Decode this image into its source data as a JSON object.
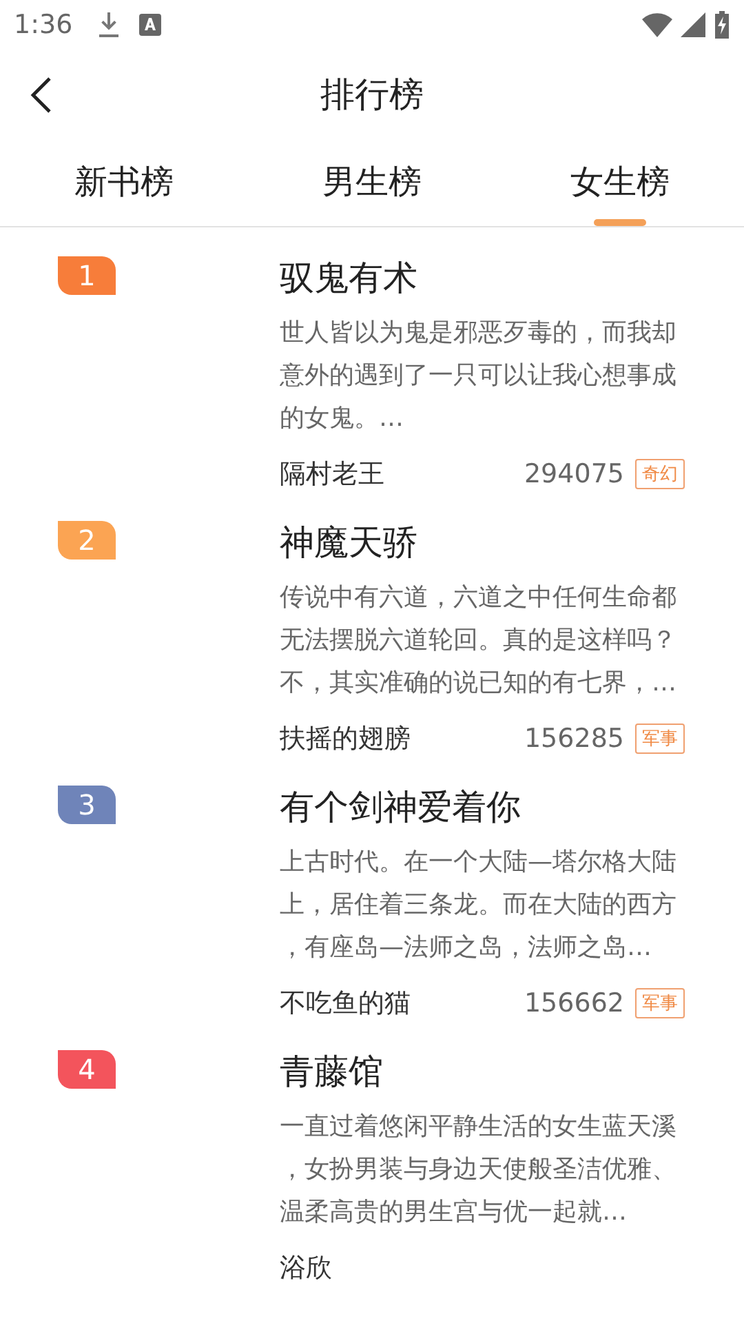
{
  "status_bar": {
    "time": "1:36"
  },
  "header": {
    "title": "排行榜"
  },
  "tabs": [
    {
      "label": "新书榜",
      "selected": false
    },
    {
      "label": "男生榜",
      "selected": false
    },
    {
      "label": "女生榜",
      "selected": true
    }
  ],
  "books": [
    {
      "rank": "1",
      "color": "#f77d3a",
      "title": "驭鬼有术",
      "description": "世人皆以为鬼是邪恶歹毒的，而我却意外的遇到了一只可以让我心想事成的女鬼。…",
      "author": "隔村老王",
      "count": "294075",
      "tag": "奇幻"
    },
    {
      "rank": "2",
      "color": "#fba453",
      "title": "神魔天骄",
      "description": "传说中有六道，六道之中任何生命都无法摆脱六道轮回。真的是这样吗？不，其实准确的说已知的有七界，…",
      "author": "扶摇的翅膀",
      "count": "156285",
      "tag": "军事"
    },
    {
      "rank": "3",
      "color": "#6f84b9",
      "title": "有个剑神爱着你",
      "description": "上古时代。在一个大陆—塔尔格大陆上，居住着三条龙。而在大陆的西方，有座岛—法师之岛，法师之岛…",
      "author": "不吃鱼的猫",
      "count": "156662",
      "tag": "军事"
    },
    {
      "rank": "4",
      "color": "#f3545c",
      "title": "青藤馆",
      "description": "一直过着悠闲平静生活的女生蓝天溪，女扮男装与身边天使般圣洁优雅、温柔高贵的男生宫与优一起就…",
      "author": "浴欣"
    }
  ]
}
